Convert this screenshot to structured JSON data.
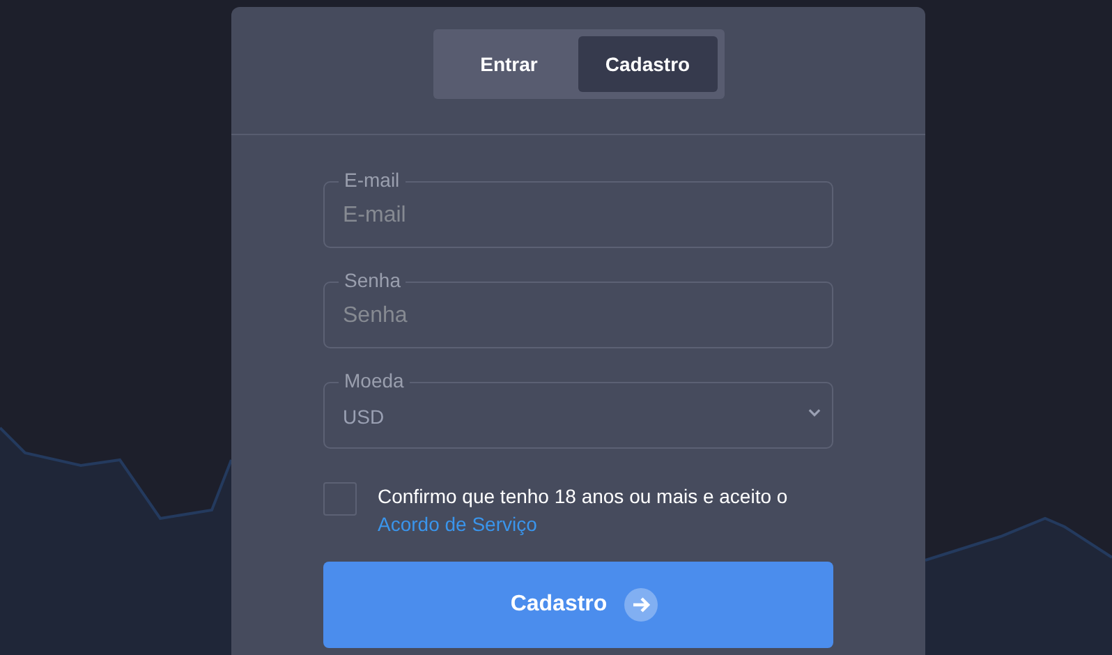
{
  "tabs": [
    {
      "label": "Entrar",
      "selected": false
    },
    {
      "label": "Cadastro",
      "selected": true
    }
  ],
  "fields": [
    {
      "kind": "text",
      "label": "E-mail",
      "placeholder": "E-mail"
    },
    {
      "kind": "password",
      "label": "Senha",
      "placeholder": "Senha"
    },
    {
      "kind": "select",
      "label": "Moeda",
      "value": "USD"
    }
  ],
  "agreement": {
    "checked": false,
    "text": "Confirmo que tenho 18 anos ou mais e aceito o",
    "link": "Acordo de Serviço"
  },
  "submit": {
    "label": "Cadastro"
  }
}
